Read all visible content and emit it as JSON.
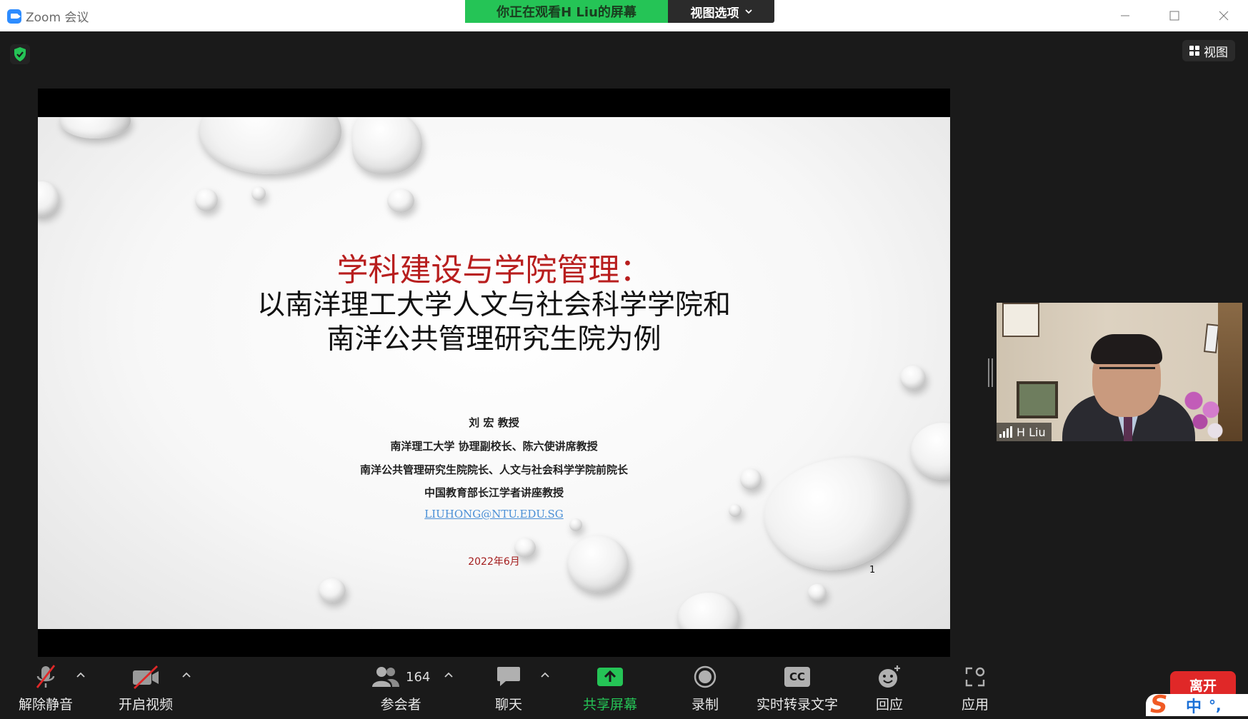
{
  "window": {
    "app_title": "Zoom 会议"
  },
  "banner": {
    "viewing_text": "你正在观看H Liu的屏幕",
    "view_options_label": "视图选项"
  },
  "view_button": {
    "label": "视图"
  },
  "slide": {
    "title_line1": "学科建设与学院管理：",
    "title_line2": "以南洋理工大学人文与社会科学学院和",
    "title_line3": "南洋公共管理研究生院为例",
    "author_name": "刘 宏 教授",
    "author_line1": "南洋理工大学 协理副校长、陈六使讲席教授",
    "author_line2": "南洋公共管理研究生院院长、人文与社会科学学院前院长",
    "author_line3": "中国教育部长江学者讲座教授",
    "email": "LIUHONG@NTU.EDU.SG",
    "date": "2022年6月",
    "page_number": "1"
  },
  "participant_video": {
    "name": "H Liu"
  },
  "toolbar": {
    "unmute": "解除静音",
    "start_video": "开启视频",
    "participants": "参会者",
    "participants_count": "164",
    "chat": "聊天",
    "share_screen": "共享屏幕",
    "record": "录制",
    "live_transcript": "实时转录文字",
    "live_transcript_icon_text": "CC",
    "reactions": "回应",
    "apps": "应用",
    "leave": "离开"
  },
  "ime": {
    "mode": "中"
  },
  "colors": {
    "banner_green": "#25c456",
    "share_green": "#25c456",
    "leave_red": "#e02828",
    "slide_title_red": "#b81e1e",
    "email_blue": "#4a8fd6"
  }
}
